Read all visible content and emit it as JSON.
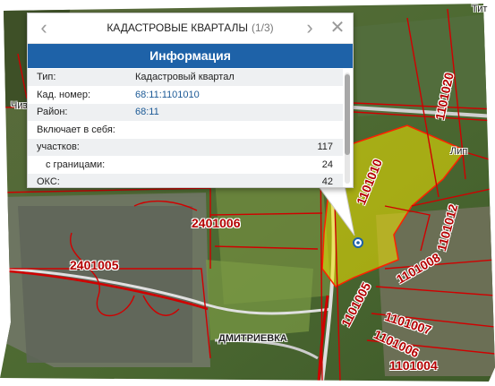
{
  "popup": {
    "title": "КАДАСТРОВЫЕ КВАРТАЛЫ",
    "page": "(1/3)",
    "header": "Информация",
    "rows": [
      {
        "key": "Тип:",
        "value": "Кадастровый квартал"
      },
      {
        "key": "Кад. номер:",
        "value": "68:11:1101010"
      },
      {
        "key": "Район:",
        "value": "68:11"
      },
      {
        "key": "Включает в себя:",
        "value": ""
      },
      {
        "key": "участков:",
        "value": "117"
      },
      {
        "key": "с границами:",
        "value": "24"
      },
      {
        "key": "ОКС:",
        "value": "42"
      }
    ],
    "icons": {
      "prev": "chevron-left-icon",
      "next": "chevron-right-icon",
      "close": "close-icon"
    }
  },
  "map": {
    "labels": {
      "q2401006": "2401006",
      "q2401005": "2401005",
      "q1101010": "1101010",
      "q1101020": "1101020",
      "q1101012": "1101012",
      "q1101008": "1101008",
      "q1101005": "1101005",
      "q1101007": "1101007",
      "q1101006": "1101006",
      "q1101004": "1101004",
      "road": "ДМИТРИЕВКА",
      "place": "Лип",
      "edge_left": "Чиз",
      "edge_right": "Тит"
    },
    "colors": {
      "highlight": "#f2e600",
      "boundary": "#d00000",
      "accent": "#1e62a8"
    }
  }
}
